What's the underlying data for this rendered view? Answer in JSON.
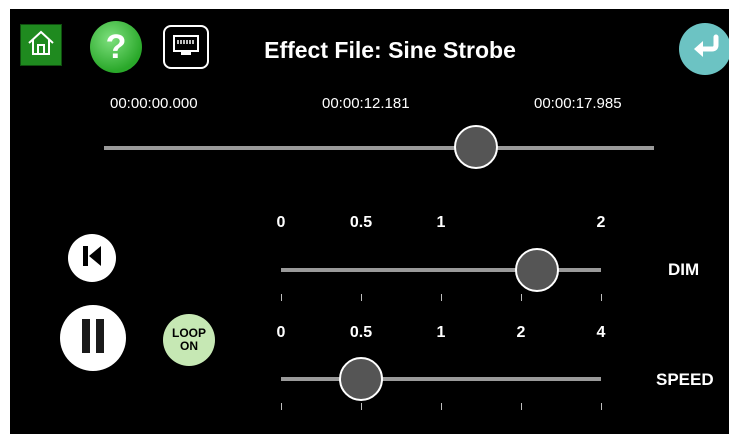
{
  "header": {
    "title": "Effect File: Sine Strobe",
    "home_icon": "home-icon",
    "help_label": "?",
    "network_icon": "ethernet-port-icon",
    "back_icon": "return-arrow-icon"
  },
  "timeline": {
    "start_time": "00:00:00.000",
    "current_time": "00:00:12.181",
    "end_time": "00:00:17.985",
    "position_fraction": 0.677
  },
  "dim": {
    "label": "DIM",
    "scale_labels": [
      "0",
      "0.5",
      "1",
      "2"
    ],
    "value": 1.6
  },
  "speed": {
    "label": "SPEED",
    "scale_labels": [
      "0",
      "0.5",
      "1",
      "2",
      "4"
    ],
    "value": 0.5
  },
  "controls": {
    "loop_line1": "LOOP",
    "loop_line2": "ON"
  },
  "colors": {
    "home": "#1f8a1f",
    "help": "#2aa82a",
    "back": "#6cc3c3",
    "loop": "#c6e8b4",
    "thumb": "#555555",
    "track": "#9a9a9a"
  }
}
